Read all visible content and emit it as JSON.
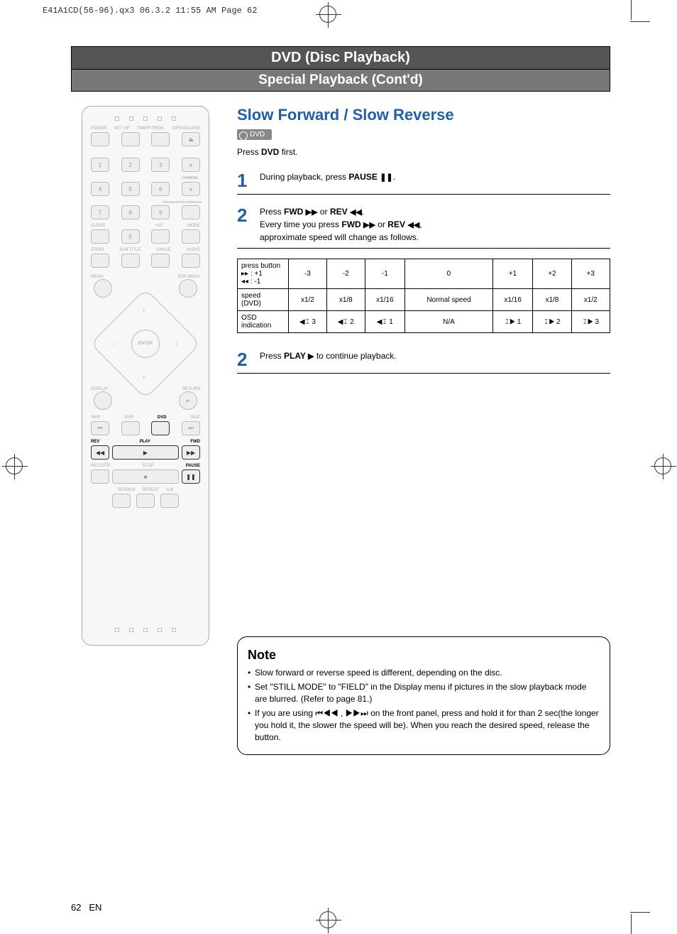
{
  "file_header": "E41A1CD(56-96).qx3  06.3.2 11:55 AM  Page 62",
  "header": "DVD (Disc Playback)",
  "subheader": "Special Playback (Cont'd)",
  "section_title": "Slow Forward / Slow Reverse",
  "dvd_badge": "DVD",
  "press_first_pre": "Press ",
  "press_first_bold": "DVD",
  "press_first_post": " first.",
  "steps": {
    "s1": {
      "num": "1",
      "pre": "During playback, press ",
      "bold": "PAUSE ",
      "post": "."
    },
    "s2": {
      "num": "2",
      "l1a": "Press ",
      "l1b": "FWD ",
      "l1c": " or ",
      "l1d": "REV ",
      "l1e": ".",
      "l2a": "Every time you press ",
      "l2b": "FWD ",
      "l2c": " or ",
      "l2d": "REV ",
      "l2e": ",",
      "l3": "approximate speed will change as follows."
    },
    "s3": {
      "num": "2",
      "pre": "Press ",
      "bold": "PLAY ",
      "post": " to continue playback."
    }
  },
  "table": {
    "h0": "press button\n▸▸ : +1\n◂◂ : -1",
    "h1": "-3",
    "h2": "-2",
    "h3": "-1",
    "h4": "0",
    "h5": "+1",
    "h6": "+2",
    "h7": "+3",
    "r1h": "speed\n(DVD)",
    "r1": [
      "x1/2",
      "x1/8",
      "x1/16",
      "Normal speed",
      "x1/16",
      "x1/8",
      "x1/2"
    ],
    "r2h": "OSD\nindication",
    "r2": [
      "◀𝙸 3",
      "◀𝙸 2",
      "◀𝙸 1",
      "N/A",
      "𝙸▶ 1",
      "𝙸▶ 2",
      "𝙸▶ 3"
    ]
  },
  "note": {
    "title": "Note",
    "items": [
      "Slow forward or reverse speed is different, depending on the disc.",
      "Set \"STILL MODE\"  to \"FIELD\" in the Display menu if pictures in the slow playback mode are blurred. (Refer to page 81.)",
      "If you are using ⏮◀◀ , ▶▶⏭ on the front panel, press and hold it for than 2 sec(the longer you hold it, the slower the speed will be). When you reach the desired speed, release the button."
    ]
  },
  "remote": {
    "row1": [
      "POWER",
      "SET UP",
      "TIMER PROG.",
      "OPEN/CLOSE"
    ],
    "numbers1": [
      "1",
      "2",
      "3"
    ],
    "numbers2": [
      "4",
      "5",
      "6"
    ],
    "numbers3": [
      "7",
      "8",
      "9"
    ],
    "rowClear": [
      "CLEAR",
      "",
      "+10",
      "MODE"
    ],
    "zero": "0",
    "rowZoom": [
      "ZOOM",
      "SUB TITLE",
      "ANGLE",
      "AUDIO"
    ],
    "menu": "MENU",
    "topmenu": "TOP MENU",
    "enter": "ENTER",
    "display": "DISPLAY",
    "return": "RETURN",
    "rowTransport1": [
      "SKIP",
      "DVR",
      "DVD",
      "SKIP"
    ],
    "rowTransport2": [
      "REV",
      "PLAY",
      "FWD"
    ],
    "rowTransport3": [
      "REC/OTR",
      "STOP",
      "PAUSE"
    ],
    "rowBottom": [
      "SEARCH",
      "REPEAT",
      "A-B"
    ],
    "channel": "CHANNEL",
    "program": "PROGRAM RECORDINGS"
  },
  "footer": {
    "page": "62",
    "lang": "EN"
  }
}
